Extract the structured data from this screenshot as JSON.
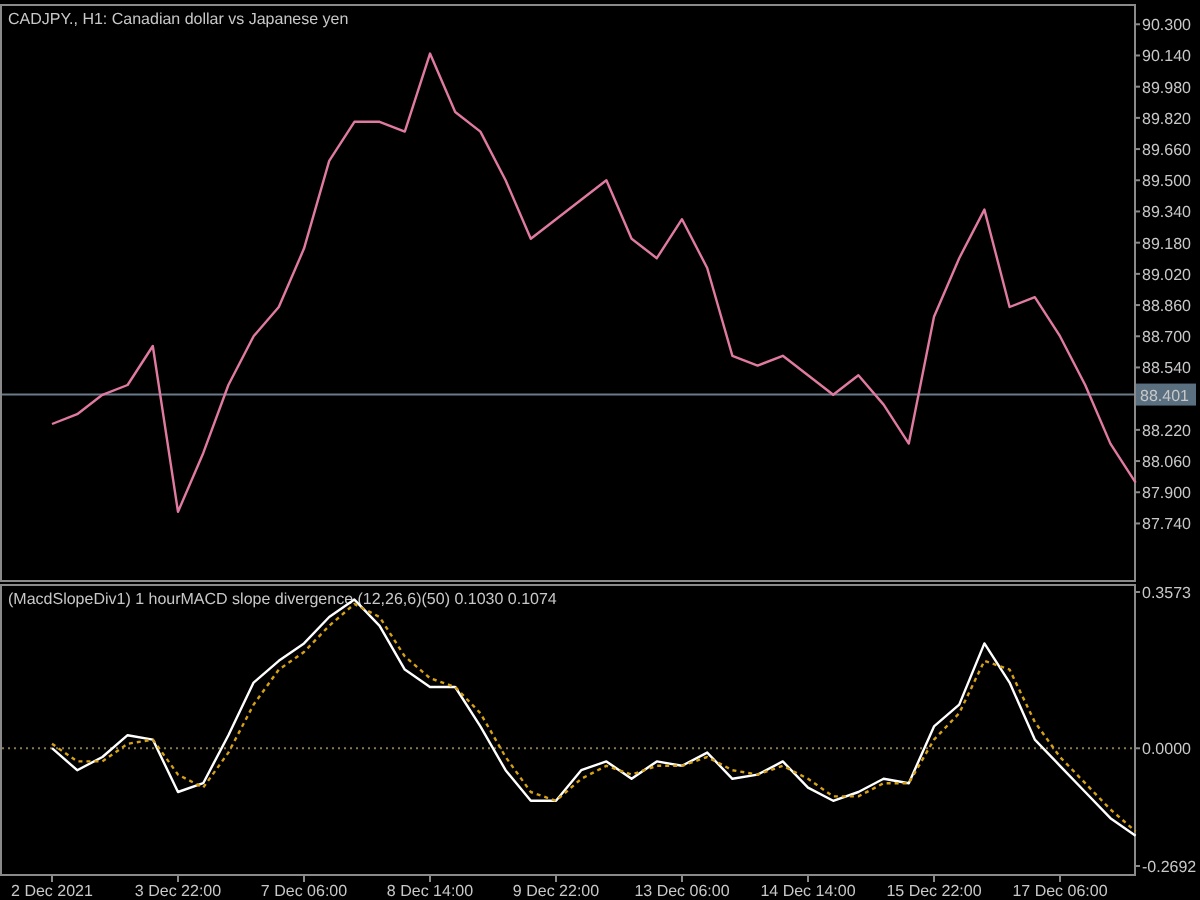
{
  "price_panel": {
    "chart_data": {
      "type": "line",
      "title": "CADJPY., H1:  Canadian dollar vs Japanese yen",
      "ylim": [
        87.45,
        90.404
      ],
      "yticks": [
        {
          "value": 90.3,
          "label": "90.300"
        },
        {
          "value": 90.14,
          "label": "90.140"
        },
        {
          "value": 89.98,
          "label": "89.980"
        },
        {
          "value": 89.82,
          "label": "89.820"
        },
        {
          "value": 89.66,
          "label": "89.660"
        },
        {
          "value": 89.5,
          "label": "89.500"
        },
        {
          "value": 89.34,
          "label": "89.340"
        },
        {
          "value": 89.18,
          "label": "89.180"
        },
        {
          "value": 89.02,
          "label": "89.020"
        },
        {
          "value": 88.86,
          "label": "88.860"
        },
        {
          "value": 88.7,
          "label": "88.700"
        },
        {
          "value": 88.54,
          "label": "88.540"
        },
        {
          "value": 88.22,
          "label": "88.220"
        },
        {
          "value": 88.06,
          "label": "88.060"
        },
        {
          "value": 87.9,
          "label": "87.900"
        },
        {
          "value": 87.74,
          "label": "87.740"
        }
      ],
      "ref_lines": [
        {
          "axis": "y",
          "value": 88.401,
          "label": "88.401",
          "color": "#6a7a8a"
        }
      ],
      "series": [
        {
          "color": "#e07aa0",
          "values": [
            88.25,
            88.3,
            88.4,
            88.45,
            88.65,
            87.8,
            88.1,
            88.45,
            88.7,
            88.85,
            89.15,
            89.6,
            89.8,
            89.8,
            89.75,
            90.15,
            89.85,
            89.75,
            89.5,
            89.2,
            89.3,
            89.4,
            89.5,
            89.2,
            89.1,
            89.3,
            89.05,
            88.6,
            88.55,
            88.6,
            88.5,
            88.4,
            88.5,
            88.35,
            88.15,
            88.8,
            89.1,
            89.35,
            88.85,
            88.9,
            88.7,
            88.45,
            88.15,
            87.95
          ]
        }
      ]
    }
  },
  "indicator_panel": {
    "chart_data": {
      "type": "line",
      "title": "(MacdSlopeDiv1) 1 hourMACD slope divergence (12,26,6)(50) 0.1030 0.1074",
      "ylim": [
        -0.2875,
        0.3756
      ],
      "yticks": [
        {
          "value": 0.3573,
          "label": "0.3573"
        },
        {
          "value": 0,
          "label": "0.0000"
        },
        {
          "value": -0.2692,
          "label": "-0.2692"
        }
      ],
      "ref_lines": [
        {
          "axis": "y",
          "value": 0,
          "color": "#8a7a50",
          "line_style": "dotted"
        }
      ],
      "categories": [
        "2 Dec 2021",
        null,
        null,
        null,
        null,
        "3 Dec 22:00",
        null,
        null,
        null,
        null,
        "7 Dec 06:00",
        null,
        null,
        null,
        null,
        "8 Dec 14:00",
        null,
        null,
        null,
        null,
        "9 Dec 22:00",
        null,
        null,
        null,
        null,
        "13 Dec 06:00",
        null,
        null,
        null,
        null,
        "14 Dec 14:00",
        null,
        null,
        null,
        null,
        "15 Dec 22:00",
        null,
        null,
        null,
        null,
        "17 Dec 06:00",
        null,
        null,
        null
      ],
      "series": [
        {
          "color": "#ffffff",
          "values": [
            0.0,
            -0.05,
            -0.02,
            0.03,
            0.02,
            -0.1,
            -0.08,
            0.03,
            0.15,
            0.2,
            0.24,
            0.3,
            0.34,
            0.28,
            0.18,
            0.14,
            0.14,
            0.05,
            -0.05,
            -0.12,
            -0.12,
            -0.05,
            -0.03,
            -0.07,
            -0.03,
            -0.04,
            -0.01,
            -0.07,
            -0.06,
            -0.03,
            -0.09,
            -0.12,
            -0.1,
            -0.07,
            -0.08,
            0.05,
            0.1,
            0.24,
            0.15,
            0.02,
            -0.04,
            -0.1,
            -0.16,
            -0.2
          ]
        },
        {
          "color": "#d4a017",
          "line_style": "dashed",
          "values": [
            0.01,
            -0.03,
            -0.03,
            0.01,
            0.02,
            -0.06,
            -0.09,
            -0.01,
            0.1,
            0.18,
            0.22,
            0.28,
            0.33,
            0.3,
            0.21,
            0.16,
            0.14,
            0.08,
            -0.02,
            -0.1,
            -0.12,
            -0.07,
            -0.04,
            -0.06,
            -0.04,
            -0.04,
            -0.02,
            -0.05,
            -0.06,
            -0.04,
            -0.07,
            -0.11,
            -0.11,
            -0.08,
            -0.08,
            0.02,
            0.08,
            0.2,
            0.18,
            0.06,
            -0.02,
            -0.08,
            -0.14,
            -0.19
          ]
        }
      ]
    }
  }
}
